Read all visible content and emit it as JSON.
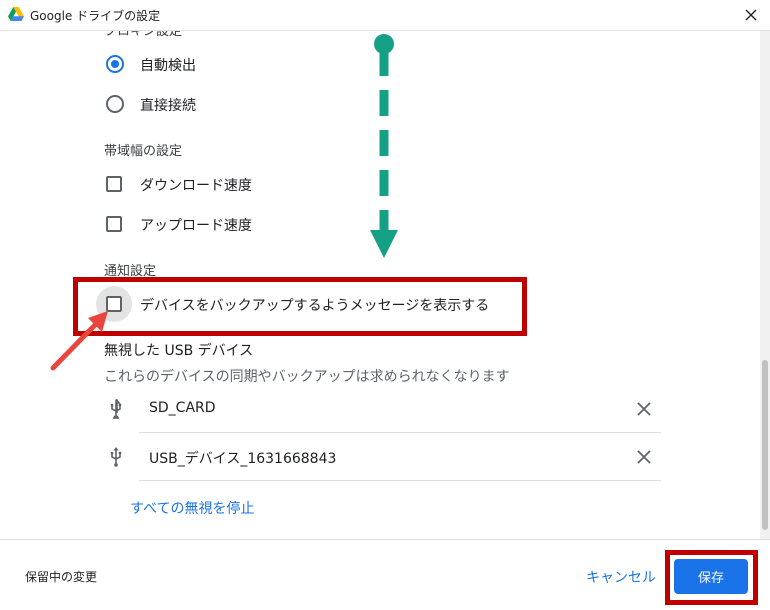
{
  "window": {
    "title": "Google ドライブの設定",
    "close_icon": "close-icon"
  },
  "proxy": {
    "heading_partial": "プロキシ設定",
    "options": [
      {
        "label": "自動検出",
        "checked": true
      },
      {
        "label": "直接接続",
        "checked": false
      }
    ]
  },
  "bandwidth": {
    "heading": "帯域幅の設定",
    "options": [
      {
        "label": "ダウンロード速度",
        "checked": false
      },
      {
        "label": "アップロード速度",
        "checked": false
      }
    ]
  },
  "notifications": {
    "heading": "通知設定",
    "option": {
      "label": "デバイスをバックアップするようメッセージを表示する",
      "checked": false
    }
  },
  "ignored_usb": {
    "heading": "無視した USB デバイス",
    "description": "これらのデバイスの同期やバックアップは求められなくなります",
    "devices": [
      {
        "name": "SD_CARD",
        "icon": "usb-icon"
      },
      {
        "name": "USB_デバイス_1631668843",
        "icon": "usb-icon"
      }
    ],
    "stop_all_link": "すべての無視を停止"
  },
  "footer": {
    "pending_label": "保留中の変更",
    "cancel_label": "キャンセル",
    "save_label": "保存"
  },
  "colors": {
    "accent": "#1a73e8",
    "highlight_red": "#c00000",
    "arrow_green": "#13a085",
    "arrow_red": "#e8453c"
  }
}
